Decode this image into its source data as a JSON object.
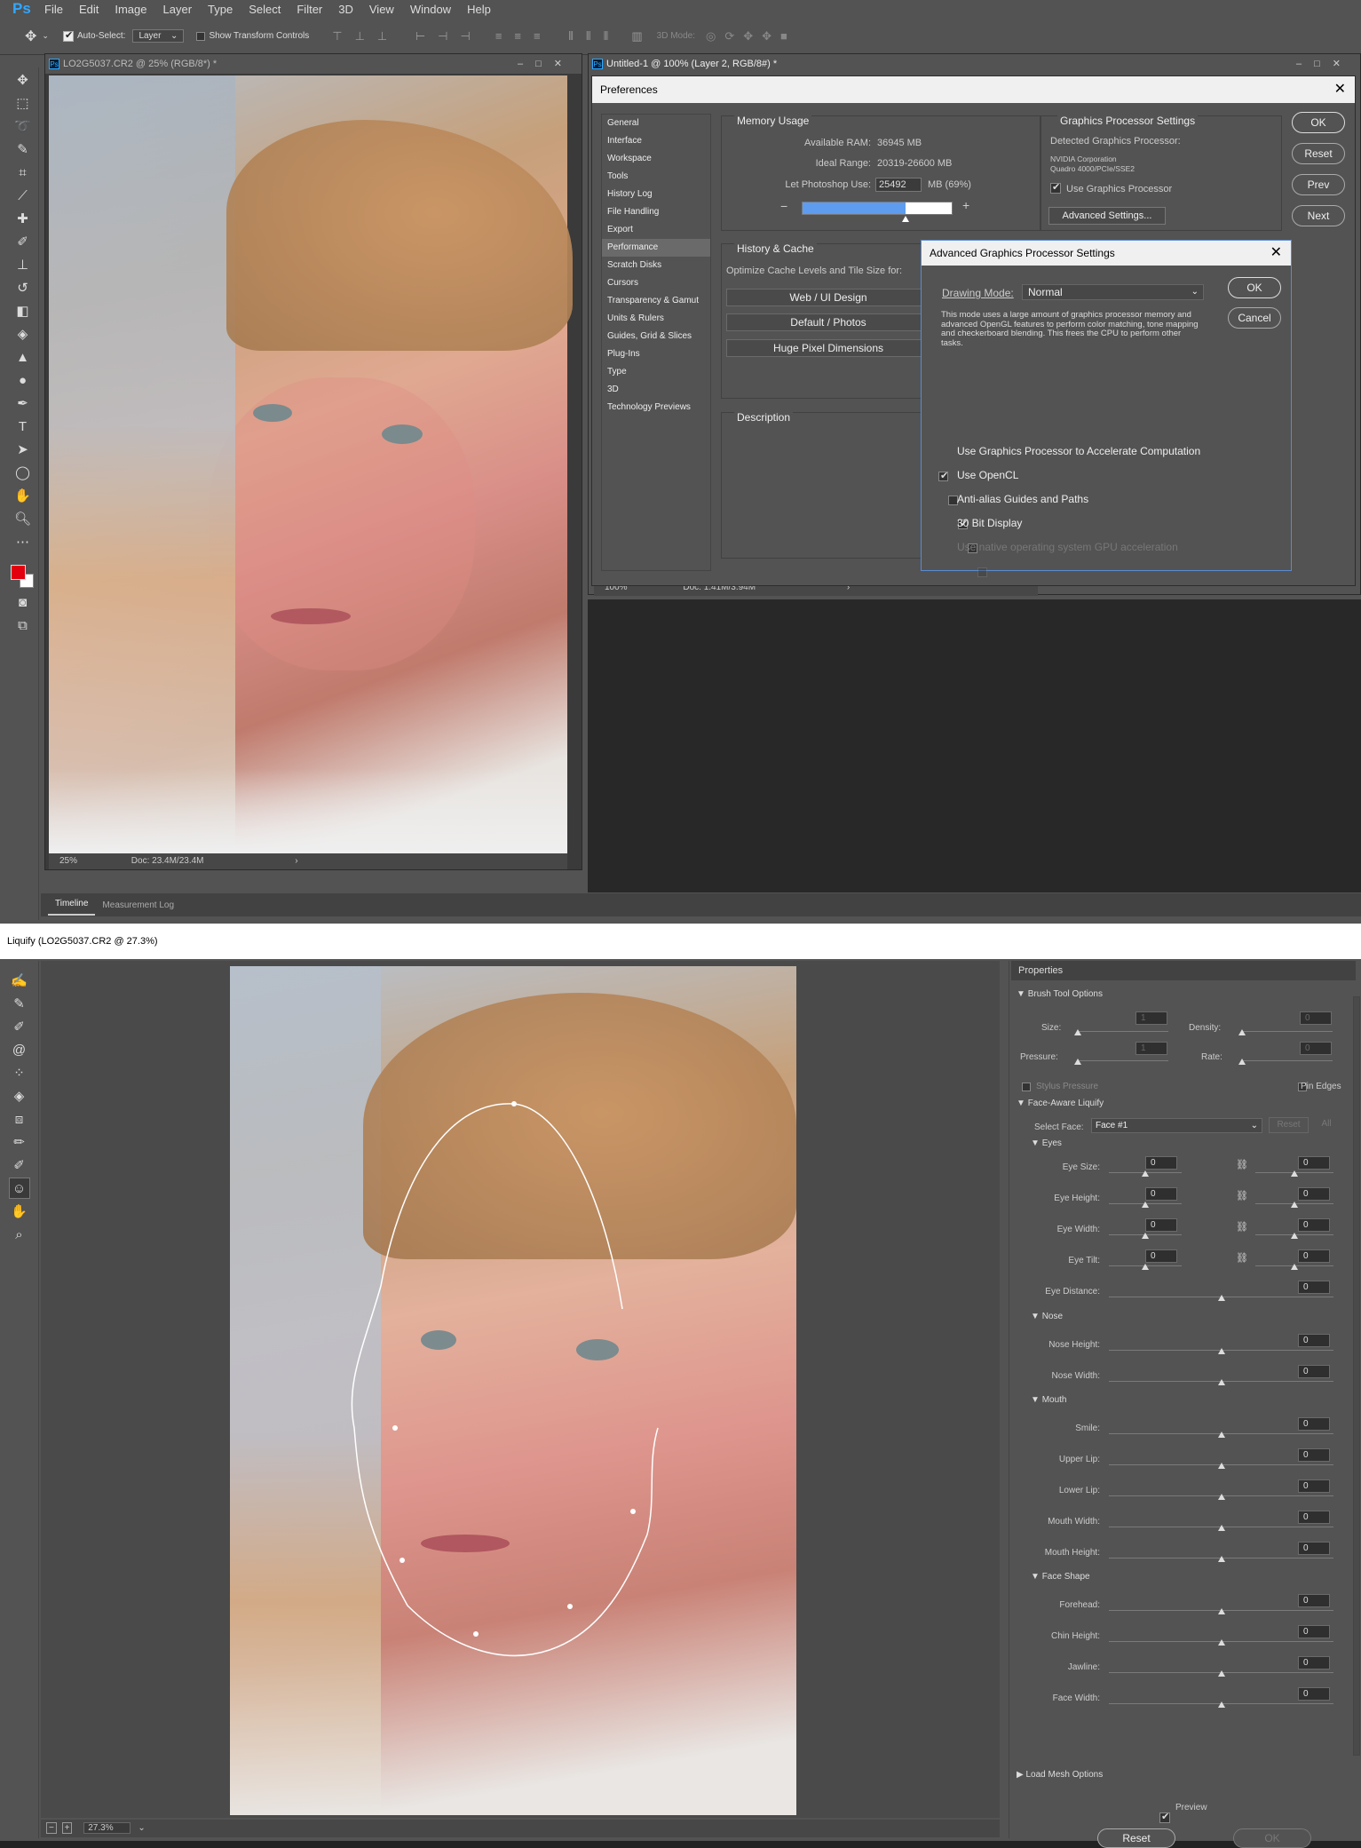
{
  "menubar": {
    "logo": "Ps",
    "items": [
      "File",
      "Edit",
      "Image",
      "Layer",
      "Type",
      "Select",
      "Filter",
      "3D",
      "View",
      "Window",
      "Help"
    ]
  },
  "optionsbar": {
    "auto_select_label": "Auto-Select:",
    "auto_select_value": "Layer",
    "show_transform_label": "Show Transform Controls",
    "mode_3d_label": "3D Mode:"
  },
  "doc1": {
    "title": "LO2G5037.CR2 @ 25% (RGB/8*) *",
    "zoom": "25%",
    "doc_info": "Doc: 23.4M/23.4M"
  },
  "doc2": {
    "title": "Untitled-1 @ 100% (Layer 2, RGB/8#) *",
    "zoom": "100%",
    "doc_info": "Doc: 1.41M/3.94M"
  },
  "bottom_tabs": [
    "Timeline",
    "Measurement Log"
  ],
  "prefs": {
    "title": "Preferences",
    "nav": [
      "General",
      "Interface",
      "Workspace",
      "Tools",
      "History Log",
      "File Handling",
      "Export",
      "Performance",
      "Scratch Disks",
      "Cursors",
      "Transparency & Gamut",
      "Units & Rulers",
      "Guides, Grid & Slices",
      "Plug-Ins",
      "Type",
      "3D",
      "Technology Previews"
    ],
    "selected_nav": "Performance",
    "memory": {
      "title": "Memory Usage",
      "available_label": "Available RAM:",
      "available_value": "36945 MB",
      "ideal_label": "Ideal Range:",
      "ideal_value": "20319-26600 MB",
      "let_label": "Let Photoshop Use:",
      "let_value": "25492",
      "let_unit": "MB (69%)",
      "fraction": 0.69
    },
    "gpu": {
      "title": "Graphics Processor Settings",
      "detected_label": "Detected Graphics Processor:",
      "vendor": "NVIDIA Corporation",
      "model": "Quadro 4000/PCIe/SSE2",
      "use_label": "Use Graphics Processor",
      "advanced_btn": "Advanced Settings..."
    },
    "history": {
      "title": "History & Cache",
      "optimize_label": "Optimize Cache Levels and Tile Size for:",
      "btn_web": "Web / UI Design",
      "btn_default": "Default / Photos",
      "btn_huge": "Huge Pixel Dimensions"
    },
    "description_title": "Description",
    "buttons": {
      "ok": "OK",
      "reset": "Reset",
      "prev": "Prev",
      "next": "Next"
    }
  },
  "advgpu": {
    "title": "Advanced Graphics Processor Settings",
    "drawing_mode_label": "Drawing Mode:",
    "drawing_mode_value": "Normal",
    "description": "This mode uses a large amount of graphics processor memory and advanced OpenGL features to perform color matching, tone mapping and checkerboard blending.  This frees the CPU to perform other tasks.",
    "ok": "OK",
    "cancel": "Cancel",
    "options": [
      {
        "label": "Use Graphics Processor to Accelerate Computation",
        "checked": true
      },
      {
        "label": "Use OpenCL",
        "checked": false
      },
      {
        "label": "Anti-alias Guides and Paths",
        "checked": true
      },
      {
        "label": "30 Bit Display",
        "checked": false
      },
      {
        "label": "Use native operating system GPU acceleration",
        "checked": false
      }
    ]
  },
  "liquify": {
    "title": "Liquify (LO2G5037.CR2 @ 27.3%)",
    "zoom": "27.3%",
    "properties_title": "Properties",
    "brush": {
      "title": "Brush Tool Options",
      "size_label": "Size:",
      "size_value": "1",
      "density_label": "Density:",
      "density_value": "0",
      "pressure_label": "Pressure:",
      "pressure_value": "1",
      "rate_label": "Rate:",
      "rate_value": "0",
      "stylus_label": "Stylus Pressure",
      "pin_label": "Pin Edges"
    },
    "face": {
      "title": "Face-Aware Liquify",
      "select_label": "Select Face:",
      "select_value": "Face #1",
      "reset": "Reset",
      "all": "All",
      "eyes_title": "Eyes",
      "eye_size": "Eye Size:",
      "eye_height": "Eye Height:",
      "eye_width": "Eye Width:",
      "eye_tilt": "Eye Tilt:",
      "eye_distance": "Eye Distance:",
      "nose_title": "Nose",
      "nose_height": "Nose Height:",
      "nose_width": "Nose Width:",
      "mouth_title": "Mouth",
      "smile": "Smile:",
      "upper_lip": "Upper Lip:",
      "lower_lip": "Lower Lip:",
      "mouth_width": "Mouth Width:",
      "mouth_height": "Mouth Height:",
      "face_title": "Face Shape",
      "forehead": "Forehead:",
      "chin_height": "Chin Height:",
      "jawline": "Jawline:",
      "face_width": "Face Width:",
      "zero": "0"
    },
    "mesh_title": "Load Mesh Options",
    "preview_label": "Preview",
    "reset_btn": "Reset",
    "ok_btn": "OK"
  }
}
